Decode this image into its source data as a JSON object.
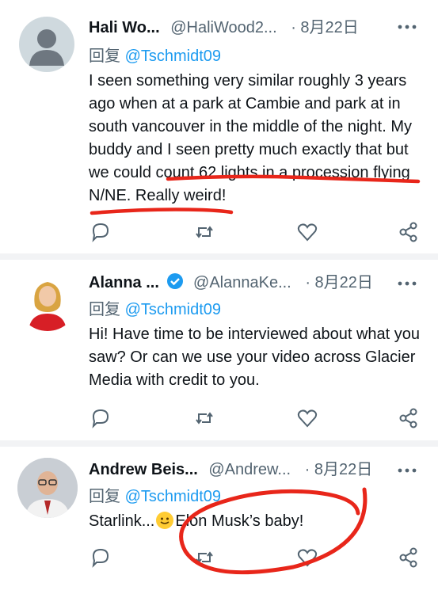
{
  "tweets": [
    {
      "name": "Hali Wo...",
      "handle": "@HaliWood2...",
      "date": "· 8月22日",
      "reply_prefix": "回复",
      "reply_to": "@Tschmidt09",
      "text": "I seen something very similar roughly 3 years ago when at a park at Cambie and park at in south vancouver in the middle of the night. My buddy and I seen pretty much exactly that but we could count 62 lights in a procession flying  N/NE. Really weird!",
      "avatar": "default-silhouette",
      "verified": false
    },
    {
      "name": "Alanna ...",
      "handle": "@AlannaKe...",
      "date": "· 8月22日",
      "reply_prefix": "回复",
      "reply_to": "@Tschmidt09",
      "text": "Hi! Have time to be interviewed about what you saw? Or can we use your video across Glacier Media with credit to you.",
      "avatar": "woman-red-dress",
      "verified": true
    },
    {
      "name": "Andrew Beis...",
      "handle": "@Andrew...",
      "date": "· 8月22日",
      "reply_prefix": "回复",
      "reply_to": "@Tschmidt09",
      "text_before_emoji": "Starlink...",
      "text_after_emoji": "Elon Musk’s baby!",
      "avatar": "man-glasses",
      "verified": false
    }
  ],
  "icons": {
    "more": "more-horizontal-icon",
    "reply": "reply-bubble-icon",
    "retweet": "retweet-icon",
    "like": "heart-icon",
    "share": "share-icon"
  },
  "colors": {
    "link": "#1d9bf0",
    "secondary_text": "#536471",
    "verified": "#1d9bf0",
    "annotation": "#e8261a"
  }
}
